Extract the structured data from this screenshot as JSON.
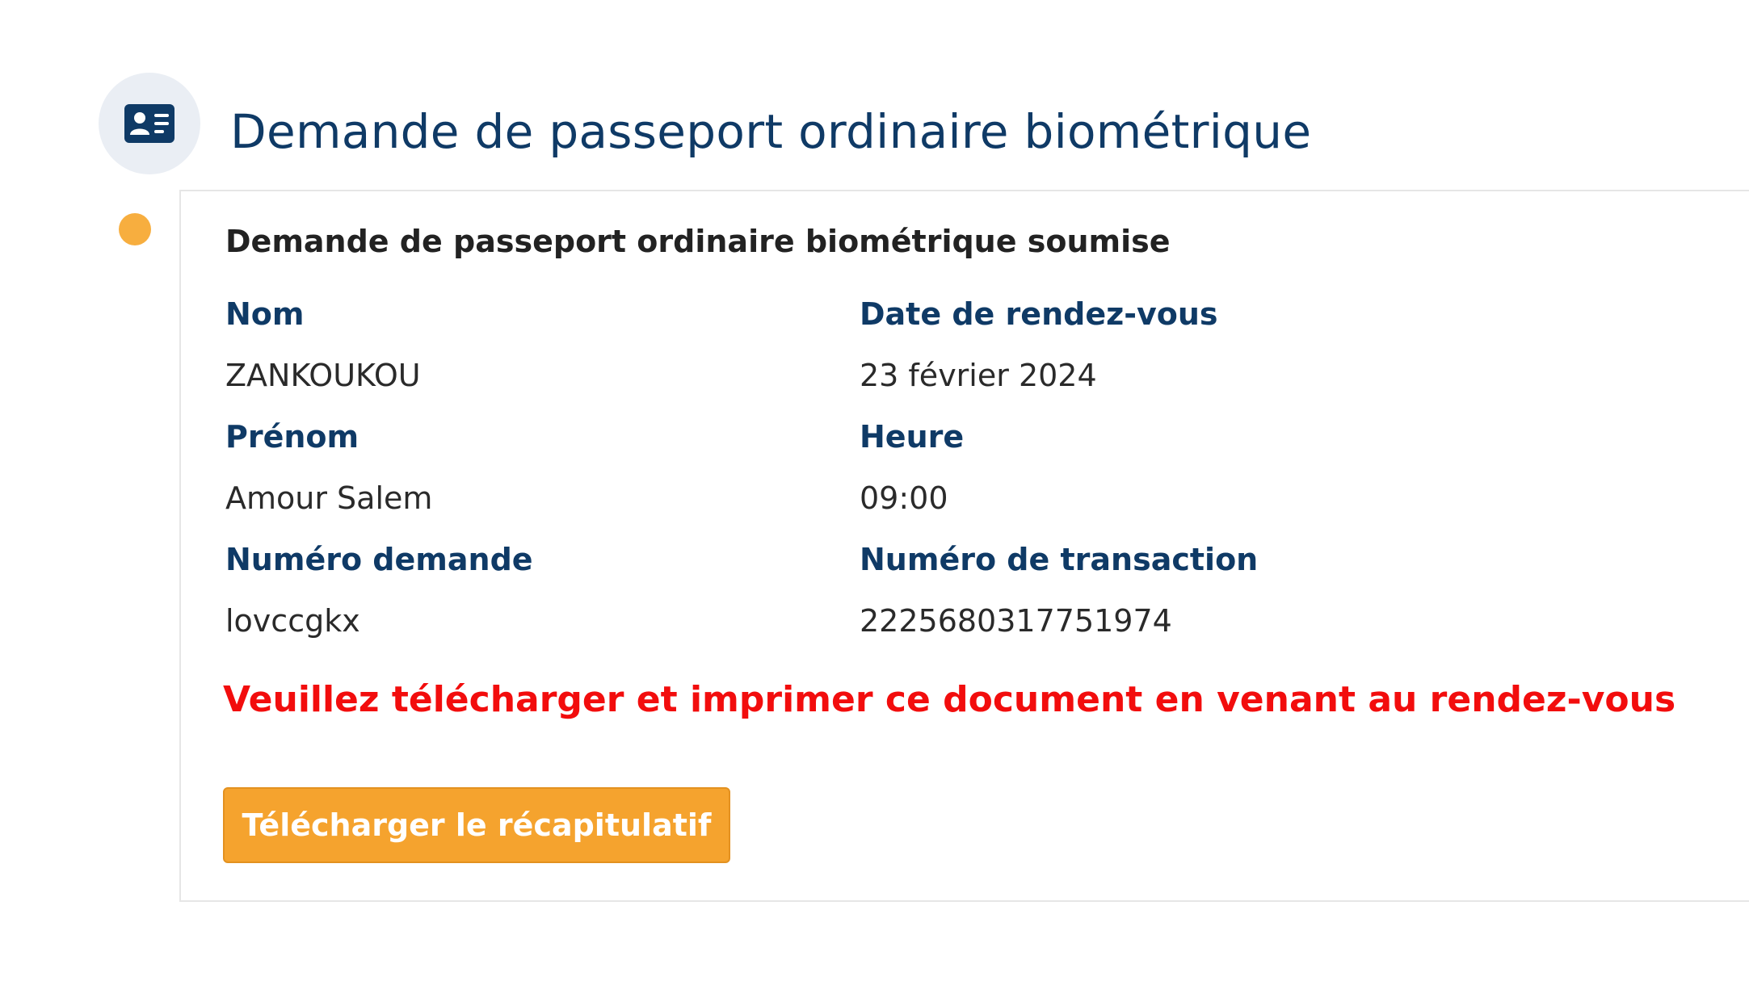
{
  "header": {
    "icon": "id-card-icon",
    "title": "Demande de passeport ordinaire biométrique"
  },
  "status": {
    "color": "#f7ae3f"
  },
  "card": {
    "title": "Demande de passeport ordinaire biométrique soumise",
    "fields": {
      "nom": {
        "label": "Nom",
        "value": "ZANKOUKOU"
      },
      "date": {
        "label": "Date de rendez-vous",
        "value": "23 février 2024"
      },
      "prenom": {
        "label": "Prénom",
        "value": "Amour Salem"
      },
      "heure": {
        "label": "Heure",
        "value": "09:00"
      },
      "numero_demande": {
        "label": "Numéro demande",
        "value": "lovccgkx"
      },
      "numero_transaction": {
        "label": "Numéro de transaction",
        "value": "2225680317751974"
      }
    },
    "warning": "Veuillez télécharger et imprimer ce document en venant au rendez-vous",
    "download_button": "Télécharger le récapitulatif"
  },
  "colors": {
    "primary": "#0f3a66",
    "accent": "#f5a32e",
    "warning": "#f20d0d"
  }
}
